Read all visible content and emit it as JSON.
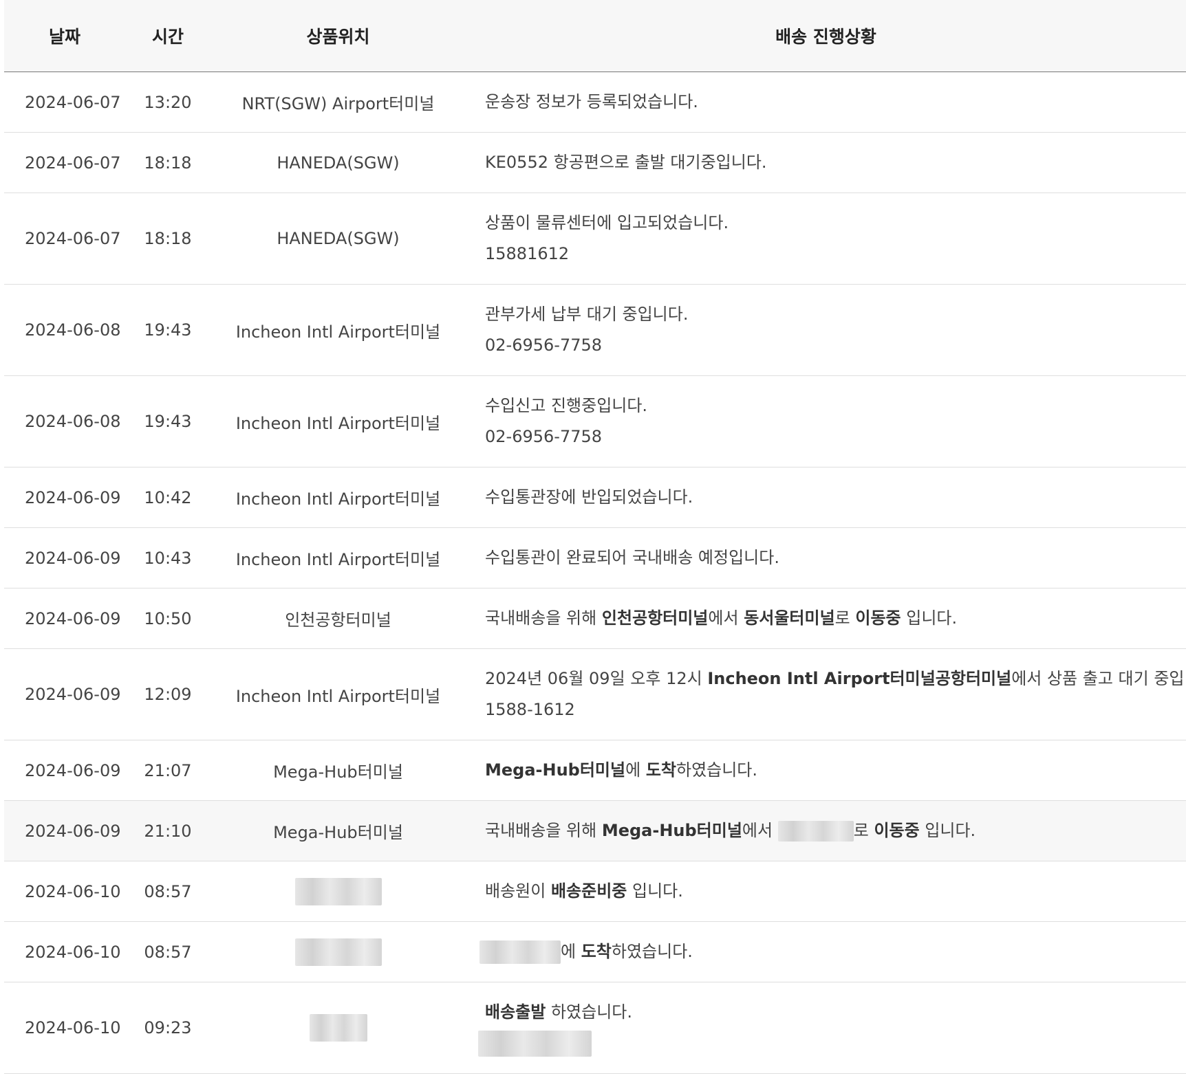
{
  "table": {
    "headers": {
      "date": "날짜",
      "time": "시간",
      "location": "상품위치",
      "status": "배송 진행상황"
    },
    "rows": [
      {
        "date": "2024-06-07",
        "time": "13:20",
        "location": "NRT(SGW) Airport터미널",
        "status": "운송장 정보가 등록되었습니다.",
        "contact": ""
      },
      {
        "date": "2024-06-07",
        "time": "18:18",
        "location": "HANEDA(SGW)",
        "status": "KE0552 항공편으로 출발 대기중입니다.",
        "contact": ""
      },
      {
        "date": "2024-06-07",
        "time": "18:18",
        "location": "HANEDA(SGW)",
        "status": "상품이 물류센터에 입고되었습니다.",
        "contact": "15881612"
      },
      {
        "date": "2024-06-08",
        "time": "19:43",
        "location": "Incheon Intl Airport터미널",
        "status": "관부가세 납부 대기 중입니다.",
        "contact": "02-6956-7758"
      },
      {
        "date": "2024-06-08",
        "time": "19:43",
        "location": "Incheon Intl Airport터미널",
        "status": "수입신고 진행중입니다.",
        "contact": "02-6956-7758"
      },
      {
        "date": "2024-06-09",
        "time": "10:42",
        "location": "Incheon Intl Airport터미널",
        "status": "수입통관장에 반입되었습니다.",
        "contact": ""
      },
      {
        "date": "2024-06-09",
        "time": "10:43",
        "location": "Incheon Intl Airport터미널",
        "status": "수입통관이 완료되어 국내배송 예정입니다.",
        "contact": ""
      },
      {
        "date": "2024-06-09",
        "time": "10:50",
        "location": "인천공항터미널",
        "status_parts": [
          "국내배송을 위해 ",
          "인천공항터미널",
          "에서 ",
          "동서울터미널",
          "로 ",
          "이동중",
          " 입니다."
        ]
      },
      {
        "date": "2024-06-09",
        "time": "12:09",
        "location": "Incheon Intl Airport터미널",
        "status_parts": [
          "2024년 06월 09일 오후 12시 ",
          "Incheon Intl Airport터미널공항터미널",
          "에서 상품 출고 대기 중입니다."
        ],
        "contact": "1588-1612"
      },
      {
        "date": "2024-06-09",
        "time": "21:07",
        "location": "Mega-Hub터미널",
        "status_parts": [
          "Mega-Hub터미널",
          "에 ",
          "도착",
          "하였습니다."
        ]
      },
      {
        "date": "2024-06-09",
        "time": "21:10",
        "location": "Mega-Hub터미널",
        "status_parts": [
          "국내배송을 위해 ",
          "Mega-Hub터미널",
          "에서 ",
          "로 ",
          "이동중",
          " 입니다."
        ]
      },
      {
        "date": "2024-06-10",
        "time": "08:57",
        "location": "",
        "status_parts": [
          "배송원이 ",
          "배송준비중",
          " 입니다."
        ]
      },
      {
        "date": "2024-06-10",
        "time": "08:57",
        "location": "",
        "status_parts": [
          "에 ",
          "도착",
          "하였습니다."
        ]
      },
      {
        "date": "2024-06-10",
        "time": "09:23",
        "location": "",
        "status_parts": [
          "배송출발",
          " 하였습니다."
        ]
      }
    ]
  }
}
